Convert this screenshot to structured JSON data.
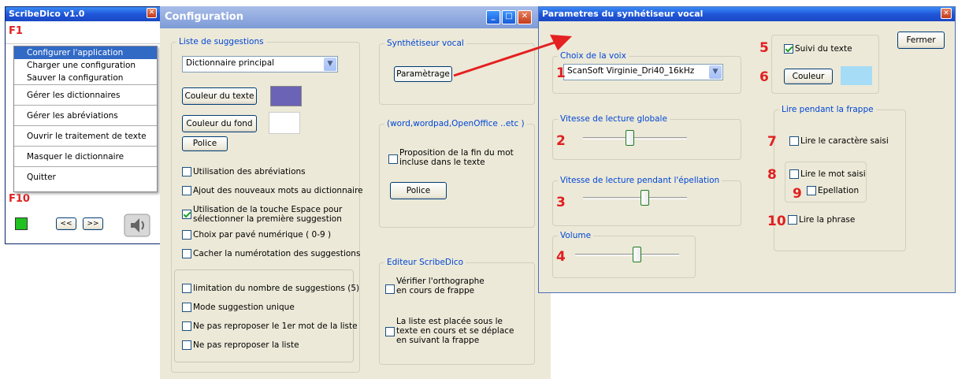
{
  "scribedico": {
    "title": "ScribeDico v1.0",
    "f1": "F1",
    "f10": "F10",
    "prev": "<<",
    "next": ">>",
    "menu": [
      "Configurer l'application",
      "Charger une configuration",
      "Sauver la configuration",
      "Gérer les dictionnaires",
      "Gérer les abréviations",
      "Ouvrir le traitement de texte",
      "Masquer le dictionnaire",
      "Quitter"
    ]
  },
  "config": {
    "title": "Configuration",
    "suggestions": {
      "legend": "Liste de suggestions",
      "dictionary": "Dictionnaire principal",
      "text_color_btn": "Couleur du texte",
      "bg_color_btn": "Couleur du fond",
      "font_btn": "Police",
      "text_swatch": "#6b63b5",
      "bg_swatch": "#ffffff",
      "options": [
        {
          "label": "Utilisation des abréviations",
          "checked": false
        },
        {
          "label": "Ajout des nouveaux mots au dictionnaire",
          "checked": false
        },
        {
          "label": "Utilisation de  la  touche Espace pour",
          "label2": "sélectionner la première suggestion",
          "checked": true
        },
        {
          "label": "Choix par pavé numérique ( 0-9 )",
          "checked": false
        },
        {
          "label": "Cacher la numérotation des suggestions",
          "checked": false
        }
      ],
      "options2": [
        {
          "label": "limitation du  nombre de suggestions (5)",
          "checked": false
        },
        {
          "label": "Mode suggestion unique",
          "checked": false
        },
        {
          "label": "Ne pas reproposer le 1er mot de la liste",
          "checked": false
        },
        {
          "label": "Ne pas reproposer la liste",
          "checked": false
        }
      ]
    },
    "synth": {
      "legend": "Synthétiseur vocal",
      "button": "Paramètrage"
    },
    "word": {
      "legend": "(word,wordpad,OpenOffice ..etc )",
      "opt1": "Proposition de la fin  du mot",
      "opt2": "incluse dans le texte",
      "font_btn": "Police"
    },
    "editor": {
      "legend": "Editeur ScribeDico",
      "opt1a": "Vérifier l'orthographe",
      "opt1b": "en cours de frappe",
      "opt2a": "La liste est placée sous le",
      "opt2b": "texte en cours et se déplace",
      "opt2c": "en suivant la frappe"
    }
  },
  "params": {
    "title": "Parametres du synhétiseur vocal",
    "close_btn": "Fermer",
    "voice_legend": "Choix de la voix",
    "voice": "ScanSoft Virginie_Dri40_16kHz",
    "global_speed": "Vitesse de lecture globale",
    "spell_speed": "Vitesse de lecture pendant l'épellation",
    "volume": "Volume",
    "global_speed_level": 0.45,
    "spell_speed_level": 0.6,
    "volume_level": 0.6,
    "follow_text": "Suivi du texte",
    "color_btn": "Couleur",
    "color_swatch": "#a6dcf5",
    "typing_legend": "Lire pendant la frappe",
    "read_char": "Lire le caractère saisi",
    "read_word": "Lire le mot saisi",
    "spelling": "Epellation",
    "read_sentence": "Lire la  phrase",
    "numbers": [
      "1",
      "2",
      "3",
      "4",
      "5",
      "6",
      "7",
      "8",
      "9",
      "10"
    ]
  }
}
